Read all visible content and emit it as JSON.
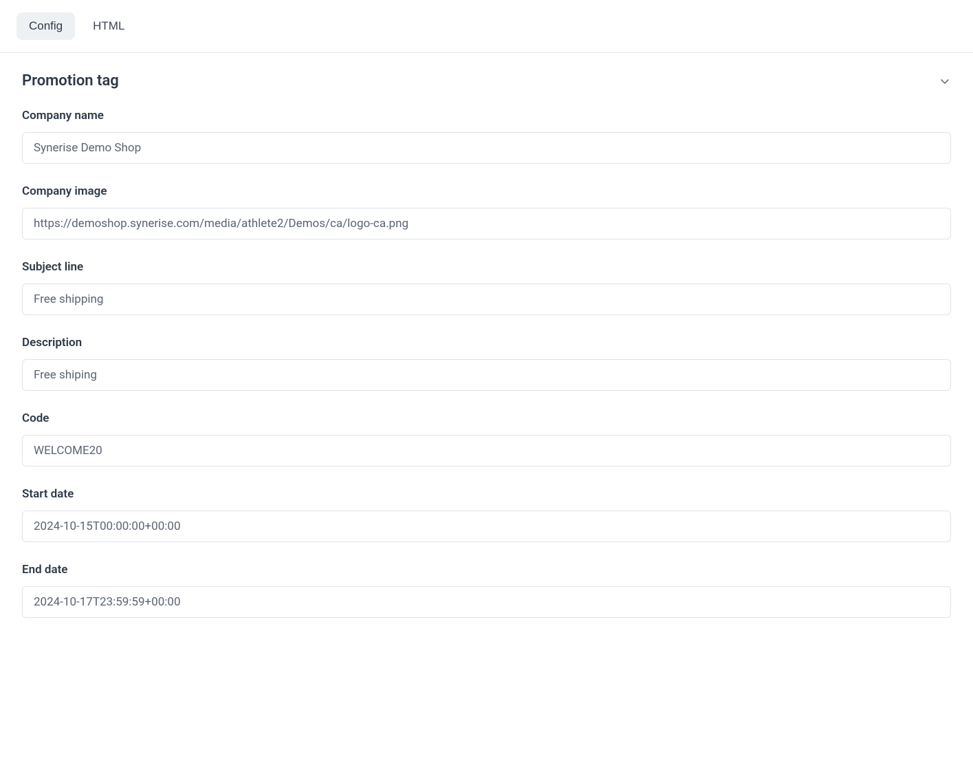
{
  "tabs": {
    "config": "Config",
    "html": "HTML"
  },
  "section": {
    "title": "Promotion tag"
  },
  "fields": {
    "company_name": {
      "label": "Company name",
      "value": "Synerise Demo Shop"
    },
    "company_image": {
      "label": "Company image",
      "value": "https://demoshop.synerise.com/media/athlete2/Demos/ca/logo-ca.png"
    },
    "subject_line": {
      "label": "Subject line",
      "value": "Free shipping"
    },
    "description": {
      "label": "Description",
      "value": "Free shiping"
    },
    "code": {
      "label": "Code",
      "value": "WELCOME20"
    },
    "start_date": {
      "label": "Start date",
      "value": "2024-10-15T00:00:00+00:00"
    },
    "end_date": {
      "label": "End date",
      "value": "2024-10-17T23:59:59+00:00"
    }
  }
}
